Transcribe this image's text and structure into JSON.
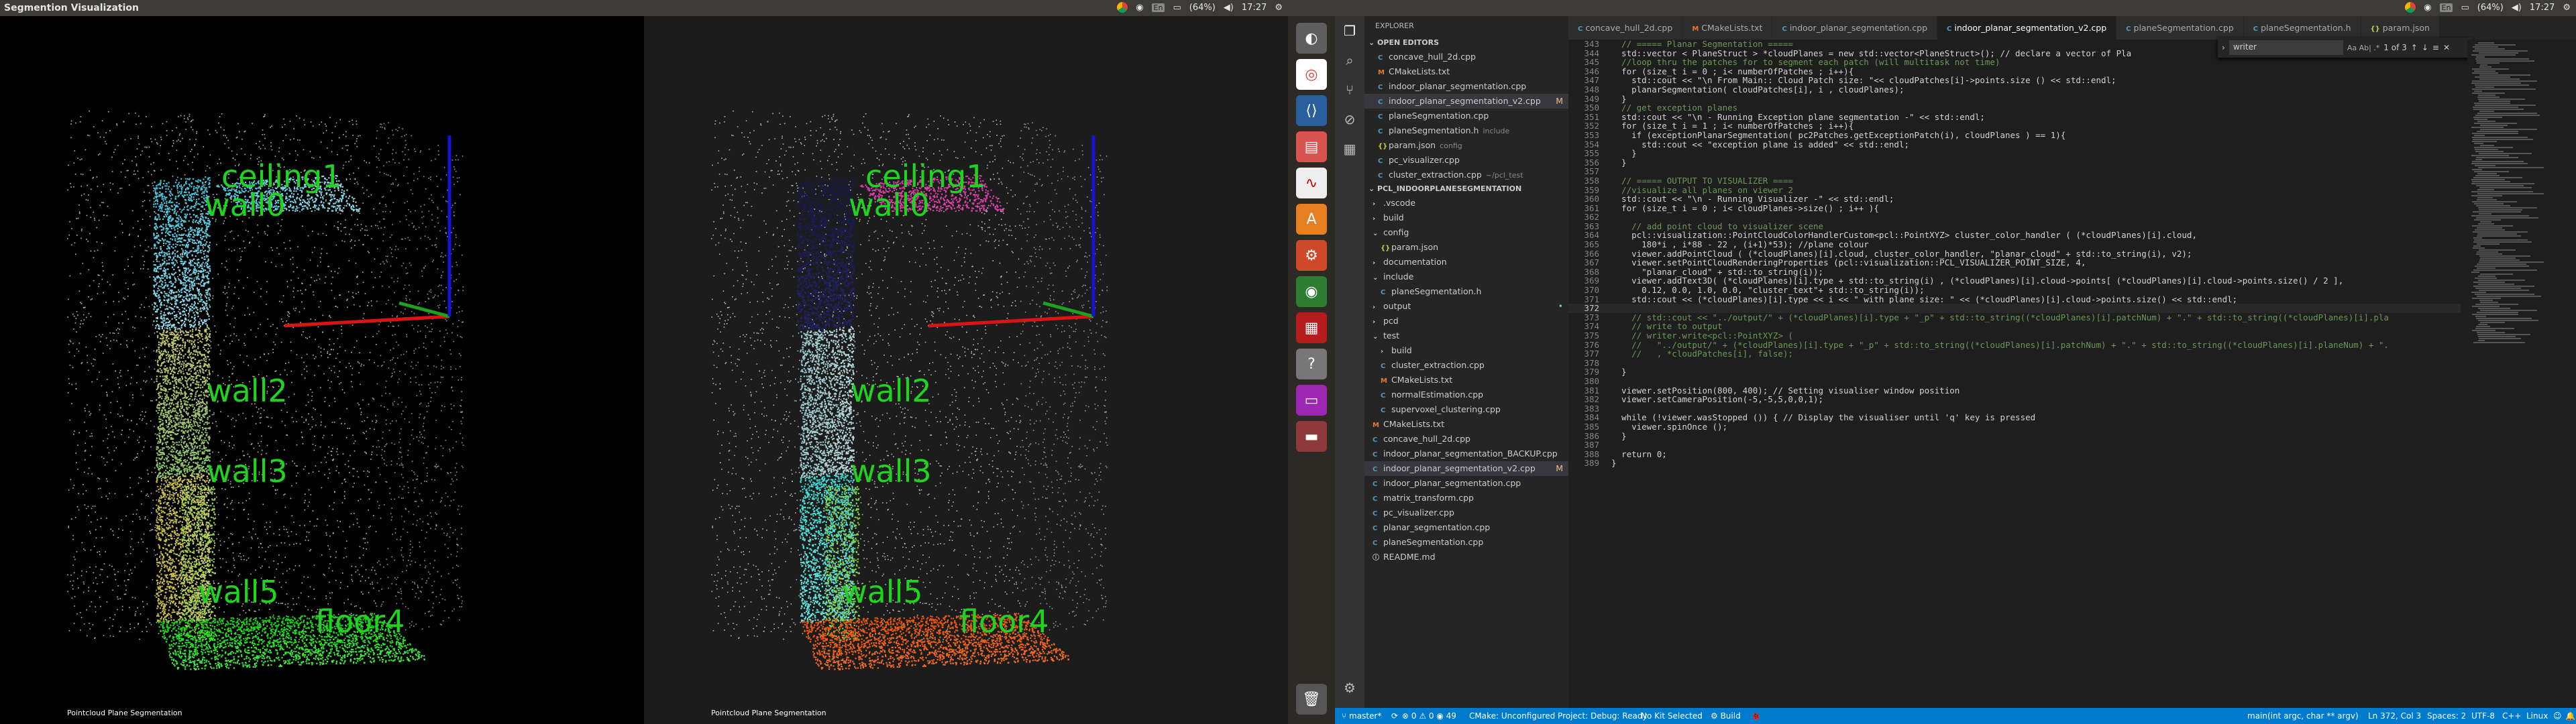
{
  "left_screen": {
    "window_title": "Segmention Visualization",
    "viewer_caption": "Pointcloud Plane Segmentation",
    "labels": [
      "ceiling1",
      "wall0",
      "wall2",
      "wall3",
      "wall5",
      "floor4"
    ]
  },
  "right_screen": {
    "viewer_caption": "Pointcloud Plane Segmentation",
    "labels": [
      "ceiling1",
      "wall0",
      "wall2",
      "wall3",
      "wall5",
      "floor4"
    ]
  },
  "system_tray": {
    "keyboard": "En",
    "battery": "(64%)",
    "time": "17:27"
  },
  "sidebar": {
    "title": "EXPLORER",
    "open_editors_header": "OPEN EDITORS",
    "open_editors": [
      {
        "icon": "C",
        "name": "concave_hull_2d.cpp"
      },
      {
        "icon": "M",
        "name": "CMakeLists.txt"
      },
      {
        "icon": "C",
        "name": "indoor_planar_segmentation.cpp"
      },
      {
        "icon": "C",
        "name": "indoor_planar_segmentation_v2.cpp",
        "mark": "M"
      },
      {
        "icon": "C",
        "name": "planeSegmentation.cpp"
      },
      {
        "icon": "C",
        "name": "planeSegmentation.h",
        "desc": "include"
      },
      {
        "icon": "{}",
        "name": "param.json",
        "desc": "config"
      },
      {
        "icon": "C",
        "name": "pc_visualizer.cpp"
      },
      {
        "icon": "C",
        "name": "cluster_extraction.cpp",
        "desc": "~/pcl_test"
      }
    ],
    "project_header": "PCL_INDOORPLANESEGMENTATION",
    "tree": [
      {
        "depth": 1,
        "icon": "›",
        "name": ".vscode"
      },
      {
        "depth": 1,
        "icon": "›",
        "name": "build"
      },
      {
        "depth": 1,
        "icon": "⌄",
        "name": "config"
      },
      {
        "depth": 2,
        "icon": "{}",
        "name": "param.json"
      },
      {
        "depth": 1,
        "icon": "›",
        "name": "documentation"
      },
      {
        "depth": 1,
        "icon": "⌄",
        "name": "include"
      },
      {
        "depth": 2,
        "icon": "C",
        "name": "planeSegmentation.h"
      },
      {
        "depth": 1,
        "icon": "›",
        "name": "output",
        "mark": "•"
      },
      {
        "depth": 1,
        "icon": "›",
        "name": "pcd"
      },
      {
        "depth": 1,
        "icon": "⌄",
        "name": "test"
      },
      {
        "depth": 2,
        "icon": "›",
        "name": "build"
      },
      {
        "depth": 2,
        "icon": "C",
        "name": "cluster_extraction.cpp"
      },
      {
        "depth": 2,
        "icon": "M",
        "name": "CMakeLists.txt"
      },
      {
        "depth": 2,
        "icon": "C",
        "name": "normalEstimation.cpp"
      },
      {
        "depth": 2,
        "icon": "C",
        "name": "supervoxel_clustering.cpp"
      },
      {
        "depth": 1,
        "icon": "M",
        "name": "CMakeLists.txt"
      },
      {
        "depth": 1,
        "icon": "C",
        "name": "concave_hull_2d.cpp"
      },
      {
        "depth": 1,
        "icon": "C",
        "name": "indoor_planar_segmentation_BACKUP.cpp"
      },
      {
        "depth": 1,
        "icon": "C",
        "name": "indoor_planar_segmentation_v2.cpp",
        "mark": "M",
        "active": true
      },
      {
        "depth": 1,
        "icon": "C",
        "name": "indoor_planar_segmentation.cpp"
      },
      {
        "depth": 1,
        "icon": "C",
        "name": "matrix_transform.cpp"
      },
      {
        "depth": 1,
        "icon": "C",
        "name": "pc_visualizer.cpp"
      },
      {
        "depth": 1,
        "icon": "C",
        "name": "planar_segmentation.cpp"
      },
      {
        "depth": 1,
        "icon": "C",
        "name": "planeSegmentation.cpp"
      },
      {
        "depth": 1,
        "icon": "ⓘ",
        "name": "README.md"
      }
    ]
  },
  "tabs": [
    {
      "icon": "C",
      "label": "concave_hull_2d.cpp"
    },
    {
      "icon": "M",
      "label": "CMakeLists.txt"
    },
    {
      "icon": "C",
      "label": "indoor_planar_segmentation.cpp"
    },
    {
      "icon": "C",
      "label": "indoor_planar_segmentation_v2.cpp",
      "active": true
    },
    {
      "icon": "C",
      "label": "planeSegmentation.cpp"
    },
    {
      "icon": "C",
      "label": "planeSegmentation.h"
    },
    {
      "icon": "{}",
      "label": "param.json"
    }
  ],
  "find_widget": {
    "query": "writer",
    "options": "Aa  Ab|  .*",
    "count": "1 of 3"
  },
  "code_lines": [
    {
      "n": "343",
      "t": "  // ===== Planar Segmentation =====",
      "c": true
    },
    {
      "n": "344",
      "t": "  std::vector < PlaneStruct > *cloudPlanes = new std::vector<PlaneStruct>(); // declare a vector of Pla"
    },
    {
      "n": "345",
      "t": "  //loop thru the patches for to segment each patch (will multitask not time)",
      "c": true
    },
    {
      "n": "346",
      "t": "  for (size_t i = 0 ; i< numberOfPatches ; i++){"
    },
    {
      "n": "347",
      "t": "    std::cout << \"\\n From Main:: Cloud Patch size: \"<< cloudPatches[i]->points.size () << std::endl;"
    },
    {
      "n": "348",
      "t": "    planarSegmentation( cloudPatches[i], i , cloudPlanes);"
    },
    {
      "n": "349",
      "t": "  }"
    },
    {
      "n": "350",
      "t": "  // get exception planes",
      "c": true
    },
    {
      "n": "351",
      "t": "  std::cout << \"\\n - Running Exception plane segmentation -\" << std::endl;"
    },
    {
      "n": "352",
      "t": "  for (size_t i = 1 ; i< numberOfPatches ; i++){"
    },
    {
      "n": "353",
      "t": "    if (exceptionPlanarSegmentation( pc2Patches.getExceptionPatch(i), cloudPlanes ) == 1){"
    },
    {
      "n": "354",
      "t": "      std::cout << \"exception plane is added\" << std::endl;"
    },
    {
      "n": "355",
      "t": "    }"
    },
    {
      "n": "356",
      "t": "  }"
    },
    {
      "n": "357",
      "t": ""
    },
    {
      "n": "358",
      "t": "  // ===== OUTPUT TO VISUALIZER ====",
      "c": true
    },
    {
      "n": "359",
      "t": "  //visualize all planes on viewer 2",
      "c": true
    },
    {
      "n": "360",
      "t": "  std::cout << \"\\n - Running Visualizer -\" << std::endl;"
    },
    {
      "n": "361",
      "t": "  for (size_t i = 0 ; i< cloudPlanes->size() ; i++ ){"
    },
    {
      "n": "362",
      "t": ""
    },
    {
      "n": "363",
      "t": "    // add point cloud to visualizer scene",
      "c": true
    },
    {
      "n": "364",
      "t": "    pcl::visualization::PointCloudColorHandlerCustom<pcl::PointXYZ> cluster_color_handler ( (*cloudPlanes)[i].cloud,"
    },
    {
      "n": "365",
      "t": "      180*i , i*88 - 22 , (i+1)*53); //plane colour"
    },
    {
      "n": "366",
      "t": "    viewer.addPointCloud ( (*cloudPlanes)[i].cloud, cluster_color_handler, \"planar_cloud\" + std::to_string(i), v2);"
    },
    {
      "n": "367",
      "t": "    viewer.setPointCloudRenderingProperties (pcl::visualization::PCL_VISUALIZER_POINT_SIZE, 4,"
    },
    {
      "n": "368",
      "t": "      \"planar_cloud\" + std::to_string(i));"
    },
    {
      "n": "369",
      "t": "    viewer.addText3D( (*cloudPlanes)[i].type + std::to_string(i) , (*cloudPlanes)[i].cloud->points[ (*cloudPlanes)[i].cloud->points.size() / 2 ],"
    },
    {
      "n": "370",
      "t": "      0.12, 0.0, 1.0, 0.0, \"cluster_text\"+ std::to_string(i));"
    },
    {
      "n": "371",
      "t": "    std::cout << (*cloudPlanes)[i].type << i << \" with plane size: \" << (*cloudPlanes)[i].cloud->points.size() << std::endl;"
    },
    {
      "n": "372",
      "t": "",
      "cur": true
    },
    {
      "n": "373",
      "t": "    // std::cout << \"../output/\" + (*cloudPlanes)[i].type + \"_p\" + std::to_string((*cloudPlanes)[i].patchNum) + \".\" + std::to_string((*cloudPlanes)[i].pla",
      "c": true
    },
    {
      "n": "374",
      "t": "    // write to output",
      "c": true
    },
    {
      "n": "375",
      "t": "    // writer.write<pcl::PointXYZ> (",
      "c": true
    },
    {
      "n": "376",
      "t": "    //   \"../output/\" + (*cloudPlanes)[i].type + \"_p\" + std::to_string((*cloudPlanes)[i].patchNum) + \".\" + std::to_string((*cloudPlanes)[i].planeNum) + \".",
      "c": true
    },
    {
      "n": "377",
      "t": "    //   , *cloudPatches[i], false);",
      "c": true
    },
    {
      "n": "378",
      "t": ""
    },
    {
      "n": "379",
      "t": "  }"
    },
    {
      "n": "380",
      "t": ""
    },
    {
      "n": "381",
      "t": "  viewer.setPosition(800, 400); // Setting visualiser window position"
    },
    {
      "n": "382",
      "t": "  viewer.setCameraPosition(-5,-5,5,0,0,1);"
    },
    {
      "n": "383",
      "t": ""
    },
    {
      "n": "384",
      "t": "  while (!viewer.wasStopped ()) { // Display the visualiser until 'q' key is pressed"
    },
    {
      "n": "385",
      "t": "    viewer.spinOnce ();"
    },
    {
      "n": "386",
      "t": "  }"
    },
    {
      "n": "387",
      "t": ""
    },
    {
      "n": "388",
      "t": "  return 0;"
    },
    {
      "n": "389",
      "t": "}"
    }
  ],
  "statusbar": {
    "branch": "master*",
    "sync": "⟳",
    "problems": "⊗ 0 ⚠ 0 ◉ 49",
    "cmake": "CMake: Unconfigured Project: Debug: Ready",
    "kit": "No Kit Selected",
    "build": "⚙ Build",
    "bug": "🐞",
    "context": "main(int argc, char ** argv)",
    "position": "Ln 372, Col 3",
    "spaces": "Spaces: 2",
    "encoding": "UTF-8",
    "language": "C++",
    "os": "Linux",
    "smile": "☺",
    "bell": "🔔"
  },
  "colors": {
    "status_blue": "#007acc",
    "label_green": "#1ed41e",
    "axis_x": "#d81414",
    "axis_y": "#1fa01f",
    "axis_z": "#1414d8"
  }
}
